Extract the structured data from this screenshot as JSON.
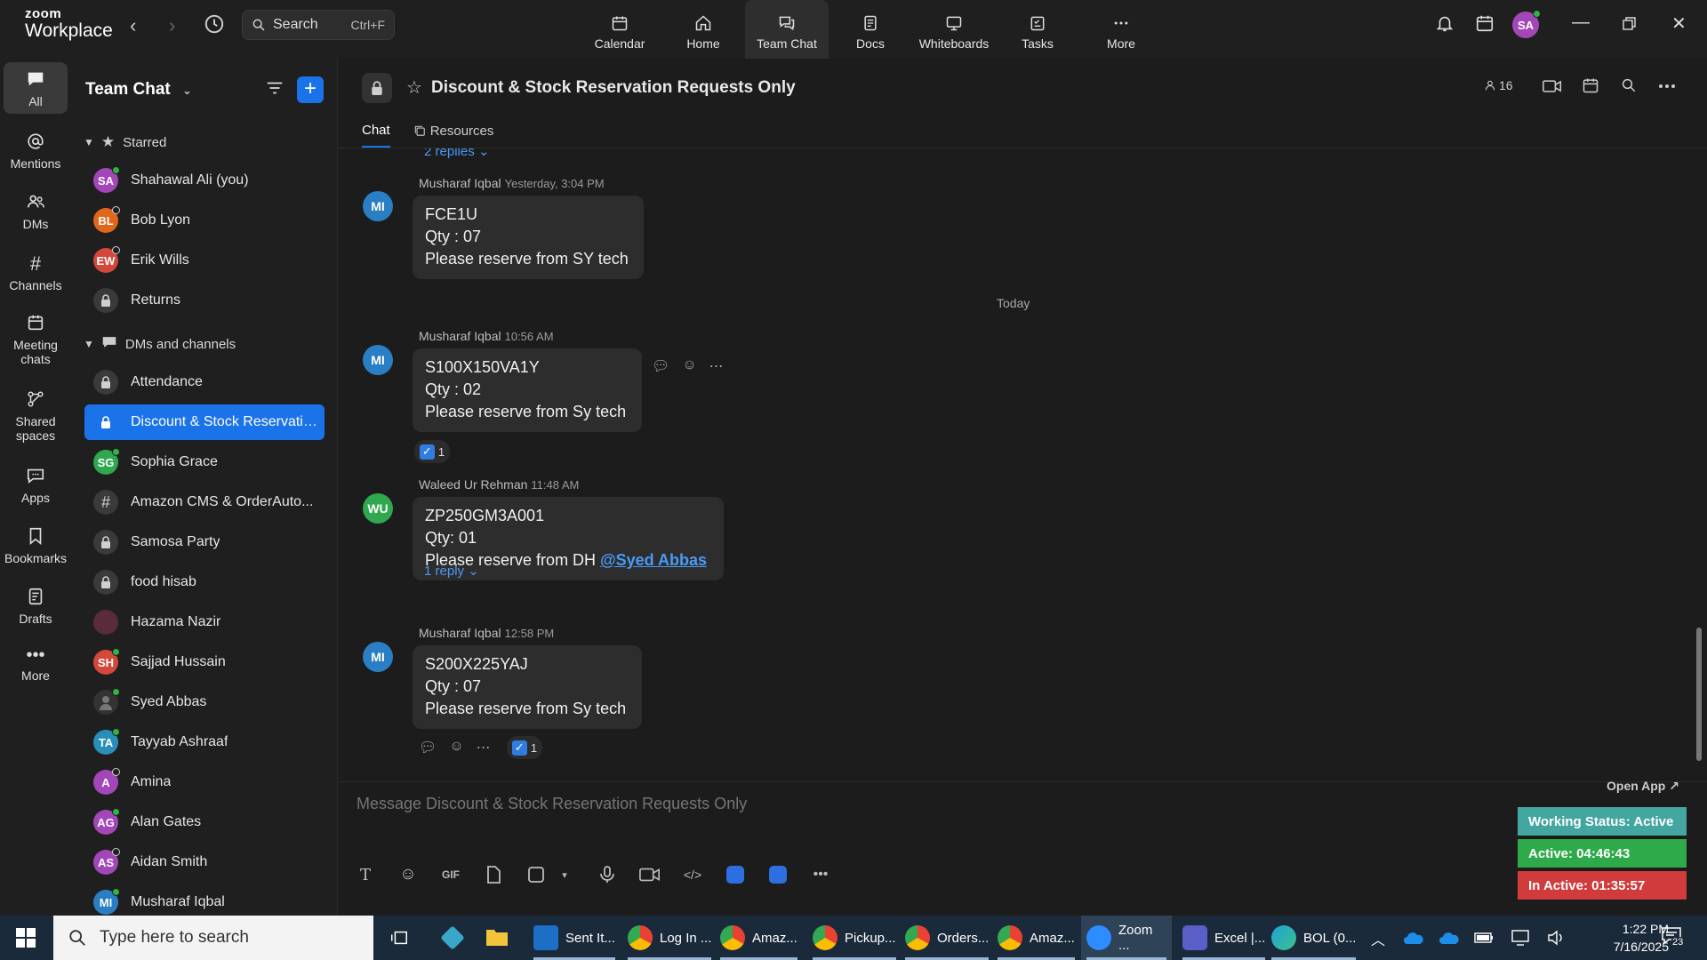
{
  "app": {
    "brand_top": "zoom",
    "brand_bottom": "Workplace"
  },
  "search": {
    "label": "Search",
    "shortcut": "Ctrl+F"
  },
  "nav_tabs": [
    {
      "label": "Calendar",
      "icon": "calendar-icon"
    },
    {
      "label": "Home",
      "icon": "home-icon"
    },
    {
      "label": "Team Chat",
      "icon": "chat-icon"
    },
    {
      "label": "Docs",
      "icon": "docs-icon"
    },
    {
      "label": "Whiteboards",
      "icon": "whiteboard-icon"
    },
    {
      "label": "Tasks",
      "icon": "tasks-icon"
    },
    {
      "label": "More",
      "icon": "more-icon"
    }
  ],
  "user_avatar": {
    "initials": "SA",
    "color": "#a346b8"
  },
  "rail": [
    {
      "label": "All"
    },
    {
      "label": "Mentions"
    },
    {
      "label": "DMs"
    },
    {
      "label": "Channels"
    },
    {
      "label": "Meeting chats"
    },
    {
      "label": "Shared spaces"
    },
    {
      "label": "Apps"
    },
    {
      "label": "Bookmarks"
    },
    {
      "label": "Drafts"
    },
    {
      "label": "More"
    }
  ],
  "sidebar": {
    "title": "Team Chat",
    "starred_label": "Starred",
    "starred": [
      {
        "initials": "SA",
        "name": "Shahawal Ali (you)",
        "color": "#a346b8",
        "status": "#2fb344"
      },
      {
        "initials": "BL",
        "name": "Bob Lyon",
        "color": "#e0661a",
        "status": "#cfcfcf"
      },
      {
        "initials": "EW",
        "name": "Erik Wills",
        "color": "#d2483b",
        "status": "#cfcfcf"
      },
      {
        "initials": "",
        "name": "Returns",
        "color": "",
        "status": ""
      }
    ],
    "dms_label": "DMs and channels",
    "dms": [
      {
        "kind": "lock",
        "name": "Attendance"
      },
      {
        "kind": "lock",
        "name": "Discount & Stock Reservatio...",
        "selected": true
      },
      {
        "kind": "avatar",
        "initials": "SG",
        "name": "Sophia Grace",
        "color": "#2fa84f",
        "status": "#2fb344"
      },
      {
        "kind": "hash",
        "name": "Amazon CMS & OrderAuto..."
      },
      {
        "kind": "lock",
        "name": "Samosa Party"
      },
      {
        "kind": "lock",
        "name": "food hisab"
      },
      {
        "kind": "avatar",
        "initials": "",
        "name": "Hazama Nazir",
        "color": "#5a2b3a",
        "status": ""
      },
      {
        "kind": "avatar",
        "initials": "SH",
        "name": "Sajjad Hussain",
        "color": "#d2483b",
        "status": "#2fb344"
      },
      {
        "kind": "avatar",
        "initials": "",
        "name": "Syed Abbas",
        "color": "#333333",
        "status": "#2fb344"
      },
      {
        "kind": "avatar",
        "initials": "TA",
        "name": "Tayyab Ashraaf",
        "color": "#2a8fb8",
        "status": "#2fb344"
      },
      {
        "kind": "avatar",
        "initials": "A",
        "name": "Amina",
        "color": "#a346b8",
        "status": "#cfcfcf"
      },
      {
        "kind": "avatar",
        "initials": "AG",
        "name": "Alan Gates",
        "color": "#a346b8",
        "status": "#2fb344"
      },
      {
        "kind": "avatar",
        "initials": "AS",
        "name": "Aidan Smith",
        "color": "#a346b8",
        "status": "#cfcfcf"
      },
      {
        "kind": "avatar",
        "initials": "MI",
        "name": "Musharaf Iqbal",
        "color": "#2a7fc4",
        "status": "#2fb344"
      }
    ]
  },
  "channel": {
    "title": "Discount & Stock Reservation Requests Only",
    "members": "16",
    "tabs": [
      "Chat",
      "Resources"
    ]
  },
  "feed": {
    "top_replies": "2 replies",
    "today_label": "Today",
    "messages": [
      {
        "initials": "MI",
        "color": "#2a7fc4",
        "author": "Musharaf Iqbal",
        "time": "Yesterday, 3:04 PM",
        "lines": [
          "FCE1U",
          "Qty : 07",
          "Please reserve from SY tech"
        ]
      },
      {
        "initials": "MI",
        "color": "#2a7fc4",
        "author": "Musharaf Iqbal",
        "time": "10:56 AM",
        "lines": [
          "S100X150VA1Y",
          "Qty : 02",
          "Please reserve from Sy tech"
        ],
        "reaction_count": "1"
      },
      {
        "initials": "WU",
        "color": "#2fa84f",
        "author": "Waleed Ur Rehman",
        "time": "11:48 AM",
        "lines": [
          "ZP250GM3A001",
          "Qty: 01",
          "Please reserve from DH "
        ],
        "mention": "@Syed Abbas",
        "replies": "1 reply"
      },
      {
        "initials": "MI",
        "color": "#2a7fc4",
        "author": "Musharaf Iqbal",
        "time": "12:58 PM",
        "lines": [
          "S200X225YAJ",
          "Qty : 07",
          "Please reserve from Sy tech"
        ],
        "reaction_count": "1"
      }
    ]
  },
  "composer": {
    "placeholder": "Message Discount & Stock Reservation Requests Only",
    "gif_label": "GIF"
  },
  "status_widget": {
    "open_app": "Open App ↗",
    "working": "Working Status: Active",
    "active": "Active: 04:46:43",
    "inactive": "In Active: 01:35:57",
    "working_color": "#43a6a0",
    "active_color": "#2faa4a",
    "inactive_color": "#d23b3b"
  },
  "taskbar": {
    "search_placeholder": "Type here to search",
    "apps": [
      {
        "label": "Sent It...",
        "color": "#1c6fc4"
      },
      {
        "label": "Log In ...",
        "color": "#e0a020"
      },
      {
        "label": "Amaz...",
        "color": "#e0a020"
      },
      {
        "label": "Pickup...",
        "color": "#e0a020"
      },
      {
        "label": "Orders...",
        "color": "#e0a020"
      },
      {
        "label": "Amaz...",
        "color": "#e0a020"
      },
      {
        "label": "Zoom ...",
        "color": "#2d8cff",
        "active": true
      },
      {
        "label": "Excel |...",
        "color": "#5a5fc8"
      },
      {
        "label": "BOL (0...",
        "color": "#1fa2d8"
      }
    ],
    "time": "1:22 PM",
    "date": "7/16/2025",
    "notifications": "23"
  }
}
